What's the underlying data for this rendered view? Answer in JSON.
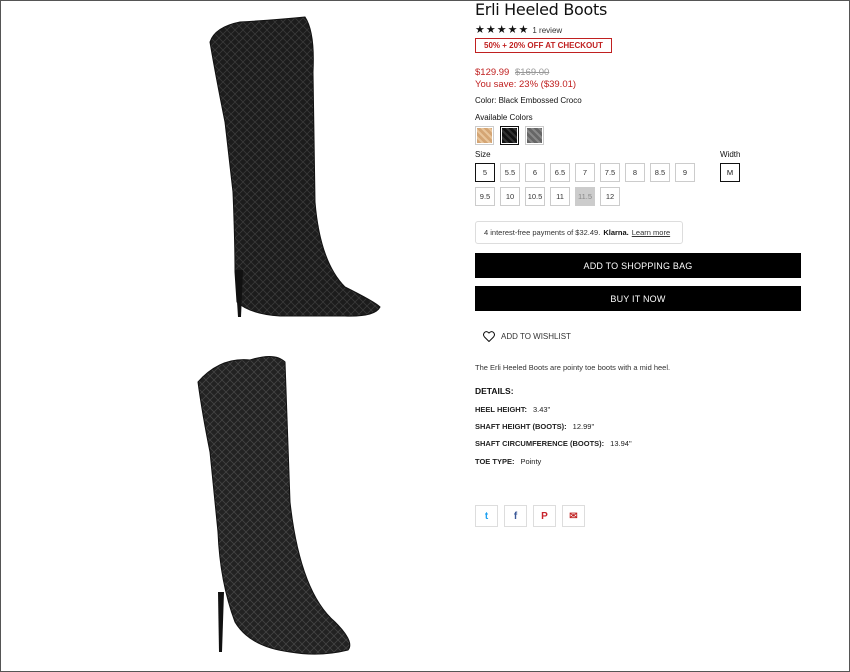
{
  "product": {
    "title": "Erli Heeled Boots",
    "rating_stars": 5,
    "review_text": "1 review",
    "promo": "50% + 20% OFF AT CHECKOUT",
    "price_sale": "$129.99",
    "price_original": "$169.00",
    "savings": "You save: 23% ($39.01)",
    "color_label": "Color: Black Embossed Croco",
    "available_colors_label": "Available Colors",
    "swatches": [
      "tan-croco-swatch",
      "black-croco-swatch",
      "grey-croco-swatch"
    ],
    "selected_swatch": 1,
    "size_label": "Size",
    "sizes": [
      "5",
      "5.5",
      "6",
      "6.5",
      "7",
      "7.5",
      "8",
      "8.5",
      "9",
      "9.5",
      "10",
      "10.5",
      "11",
      "11.5",
      "12"
    ],
    "selected_size": "5",
    "unavailable_size": "11.5",
    "width_label": "Width",
    "width_value": "M",
    "klarna_pre": "4 interest-free payments of $32.49.",
    "klarna_brand": "Klarna.",
    "klarna_link": "Learn more",
    "add_to_bag": "ADD TO SHOPPING BAG",
    "buy_now": "BUY IT NOW",
    "wishlist": "ADD TO WISHLIST",
    "description": "The Erli Heeled Boots are pointy toe boots with a mid heel.",
    "details_heading": "DETAILS:",
    "details": [
      {
        "key": "HEEL HEIGHT:",
        "value": "3.43\""
      },
      {
        "key": "SHAFT HEIGHT (BOOTS):",
        "value": "12.99\""
      },
      {
        "key": "SHAFT CIRCUMFERENCE (BOOTS):",
        "value": "13.94\""
      },
      {
        "key": "TOE TYPE:",
        "value": "Pointy"
      }
    ],
    "share": [
      {
        "name": "twitter",
        "glyph": "t",
        "color": "#1da1f2"
      },
      {
        "name": "facebook",
        "glyph": "f",
        "color": "#3b5998"
      },
      {
        "name": "pinterest",
        "glyph": "P",
        "color": "#c8232c"
      },
      {
        "name": "email",
        "glyph": "✉",
        "color": "#c02020"
      }
    ]
  },
  "colors": {
    "sale": "#c02020",
    "button": "#000000"
  }
}
